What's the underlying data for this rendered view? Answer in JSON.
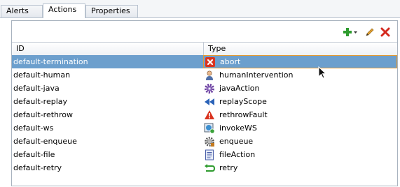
{
  "tabs": [
    {
      "label": "Alerts",
      "active": false
    },
    {
      "label": "Actions",
      "active": true
    },
    {
      "label": "Properties",
      "active": false
    }
  ],
  "toolbar": {
    "add_icon": "add-icon",
    "edit_icon": "edit-icon",
    "delete_icon": "delete-icon",
    "add_color": "#2e9b2e",
    "delete_color": "#d42a1f"
  },
  "table": {
    "headers": [
      "ID",
      "Type"
    ],
    "rows": [
      {
        "id": "default-termination",
        "type": "abort",
        "icon": "abort-icon",
        "selected": true
      },
      {
        "id": "default-human",
        "type": "humanIntervention",
        "icon": "person-icon",
        "selected": false
      },
      {
        "id": "default-java",
        "type": "javaAction",
        "icon": "gear-icon",
        "selected": false
      },
      {
        "id": "default-replay",
        "type": "replayScope",
        "icon": "rewind-icon",
        "selected": false
      },
      {
        "id": "default-rethrow",
        "type": "rethrowFault",
        "icon": "warning-icon",
        "selected": false
      },
      {
        "id": "default-ws",
        "type": "invokeWS",
        "icon": "webservice-icon",
        "selected": false
      },
      {
        "id": "default-enqueue",
        "type": "enqueue",
        "icon": "queue-icon",
        "selected": false
      },
      {
        "id": "default-file",
        "type": "fileAction",
        "icon": "file-icon",
        "selected": false
      },
      {
        "id": "default-retry",
        "type": "retry",
        "icon": "retry-icon",
        "selected": false
      }
    ]
  },
  "colors": {
    "selection": "#6c9fcd",
    "focus_border": "#e59a31"
  }
}
